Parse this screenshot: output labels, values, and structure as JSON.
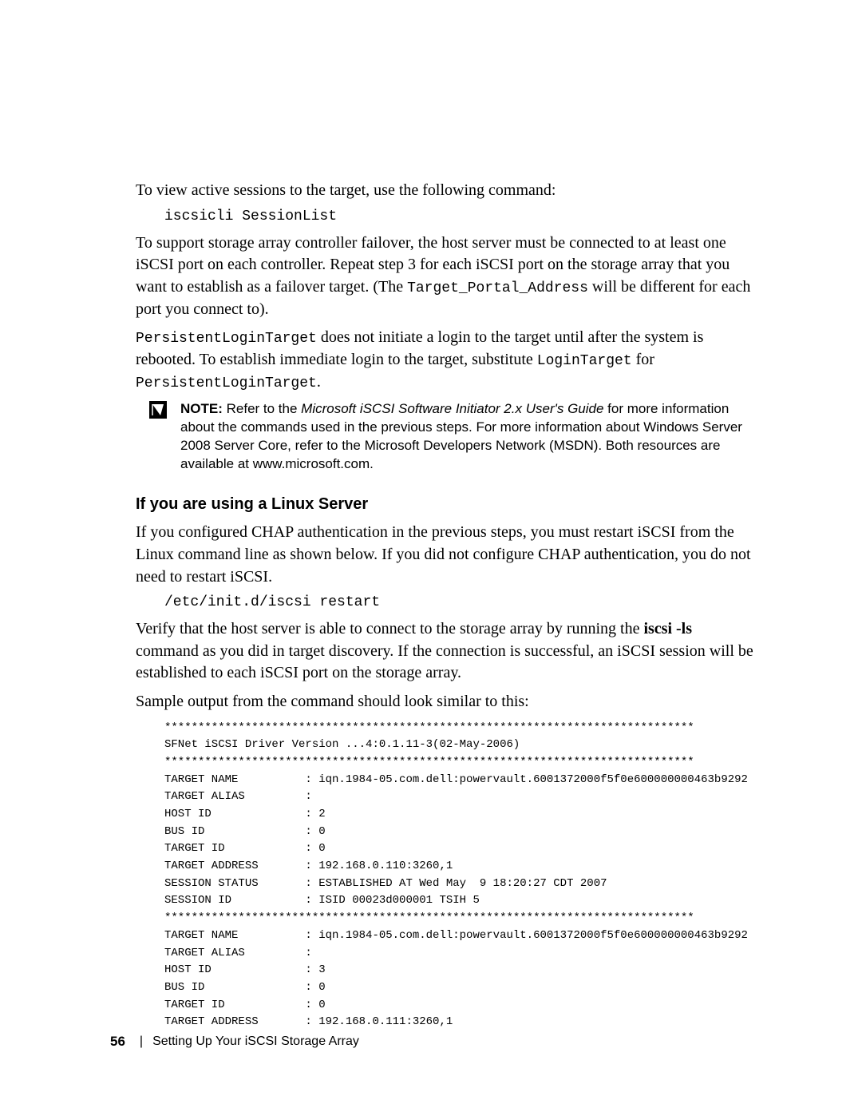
{
  "p1": "To view active sessions to the target, use the following command:",
  "cmd1": "iscsicli SessionList",
  "p2a": "To support storage array controller failover, the host server must be connected to at least one iSCSI port on each controller. Repeat step 3 for each iSCSI port on the storage array that you want to establish as a failover target. (The ",
  "code_tp": "Target_Portal_Address",
  "p2b": " will be different for each port you connect to).",
  "code_plt": "PersistentLoginTarget",
  "p3a": " does not initiate a login to the target until after the system is rebooted. To establish immediate login to the target, substitute ",
  "code_lt": "LoginTarget",
  "p3b": " for ",
  "code_plt2": "PersistentLoginTarget",
  "p3c": ".",
  "note": {
    "label": "NOTE:",
    "a": " Refer to the ",
    "italic": "Microsoft iSCSI Software Initiator 2.x User's Guide",
    "b": " for more information about the commands used in the previous steps. For more information about Windows Server 2008 Server Core, refer to the Microsoft Developers Network (MSDN). Both resources are available at www.microsoft.com."
  },
  "heading": "If you are using a Linux Server",
  "p4": "If you configured CHAP authentication in the previous steps, you must restart iSCSI from the Linux command line as shown below. If you did not configure CHAP authentication, you do not need to restart iSCSI.",
  "cmd2": "/etc/init.d/iscsi restart",
  "p5a": "Verify that the host server is able to connect to the storage array by running the ",
  "bold_cmd": "iscsi -ls",
  "p5b": " command as you did in target discovery. If the connection is successful, an iSCSI session will be established to each iSCSI port on the storage array.",
  "p6": "Sample output from the command should look similar to this:",
  "output": "*******************************************************************************\nSFNet iSCSI Driver Version ...4:0.1.11-3(02-May-2006)\n*******************************************************************************\nTARGET NAME          : iqn.1984-05.com.dell:powervault.6001372000f5f0e600000000463b9292\nTARGET ALIAS         :\nHOST ID              : 2\nBUS ID               : 0\nTARGET ID            : 0\nTARGET ADDRESS       : 192.168.0.110:3260,1\nSESSION STATUS       : ESTABLISHED AT Wed May  9 18:20:27 CDT 2007\nSESSION ID           : ISID 00023d000001 TSIH 5\n*******************************************************************************\nTARGET NAME          : iqn.1984-05.com.dell:powervault.6001372000f5f0e600000000463b9292\nTARGET ALIAS         :\nHOST ID              : 3\nBUS ID               : 0\nTARGET ID            : 0\nTARGET ADDRESS       : 192.168.0.111:3260,1",
  "footer": {
    "page": "56",
    "title": "Setting Up Your iSCSI Storage Array"
  }
}
